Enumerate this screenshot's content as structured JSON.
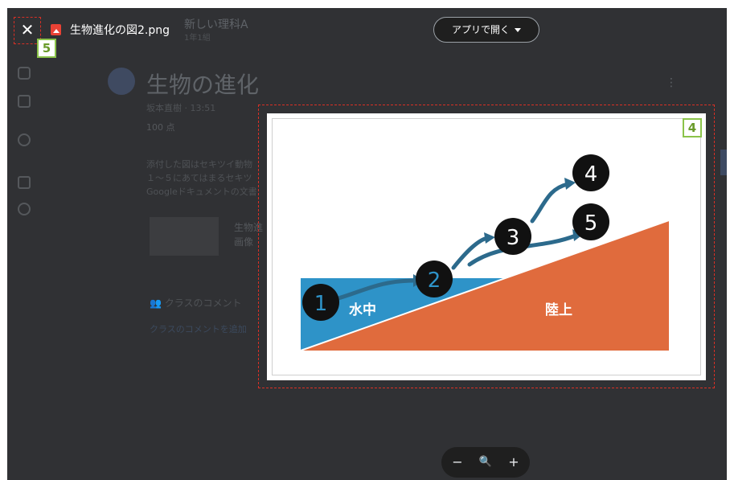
{
  "viewer": {
    "file_name": "生物進化の図2.png",
    "open_with_label": "アプリで開く",
    "close_symbol": "✕",
    "zoom_out_symbol": "−",
    "zoom_symbol": "🔍",
    "zoom_in_symbol": "+"
  },
  "background_page": {
    "breadcrumb": "新しい理科A",
    "breadcrumb_sub": "1年1組",
    "assignment_title": "生物の進化",
    "meta": "坂本直樹 · 13:51",
    "points": "100 点",
    "description_lines": [
      "添付した図はセキツイ動物",
      "１～５にあてはまるセキツ",
      "Googleドキュメントの文書"
    ],
    "attachment_title": "生物進",
    "attachment_type": "画像",
    "class_comments": "クラスのコメント",
    "add_comment": "クラスのコメントを追加"
  },
  "diagram": {
    "label_water": "水中",
    "label_land": "陸上",
    "nodes": [
      "1",
      "2",
      "3",
      "4",
      "5"
    ],
    "colors": {
      "water": "#2e93c8",
      "land": "#e06b3d",
      "node": "#111111",
      "arrow": "#2c6a8c"
    }
  },
  "annotations": {
    "badge_image": "4",
    "badge_close": "5"
  }
}
